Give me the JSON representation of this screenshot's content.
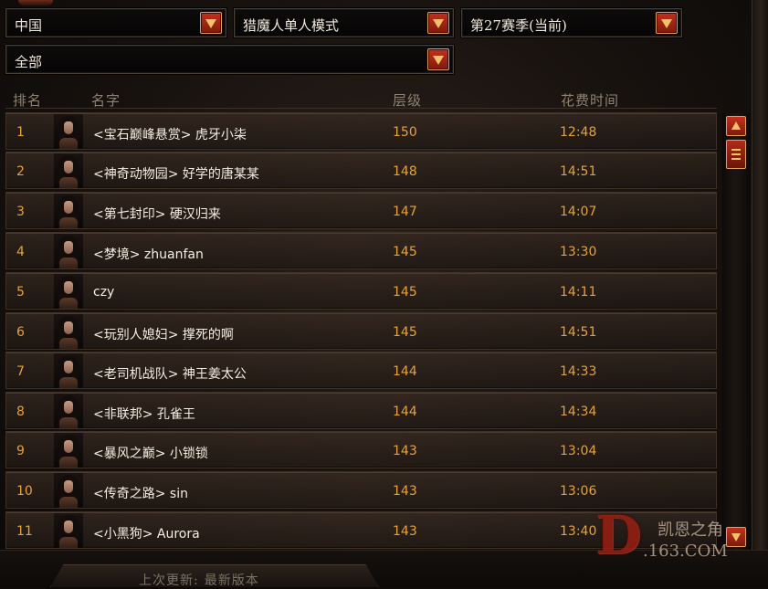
{
  "filters": {
    "region": "中国",
    "mode": "猎魔人单人模式",
    "season": "第27赛季(当前)",
    "class_filter": "全部"
  },
  "table": {
    "headers": {
      "rank": "排名",
      "name": "名字",
      "level": "层级",
      "time": "花费时间"
    },
    "rows": [
      {
        "rank": "1",
        "name": "<宝石巅峰悬赏> 虎牙小柒",
        "level": "150",
        "time": "12:48"
      },
      {
        "rank": "2",
        "name": "<神奇动物园> 好学的唐某某",
        "level": "148",
        "time": "14:51"
      },
      {
        "rank": "3",
        "name": "<第七封印> 硬汉归来",
        "level": "147",
        "time": "14:07"
      },
      {
        "rank": "4",
        "name": "<梦境> zhuanfan",
        "level": "145",
        "time": "13:30"
      },
      {
        "rank": "5",
        "name": "czy",
        "level": "145",
        "time": "14:11"
      },
      {
        "rank": "6",
        "name": "<玩别人媳妇> 撑死的啊",
        "level": "145",
        "time": "14:51"
      },
      {
        "rank": "7",
        "name": "<老司机战队> 神王姜太公",
        "level": "144",
        "time": "14:33"
      },
      {
        "rank": "8",
        "name": "<非联邦> 孔雀王",
        "level": "144",
        "time": "14:34"
      },
      {
        "rank": "9",
        "name": "<暴风之巅> 小锁锁",
        "level": "143",
        "time": "13:04"
      },
      {
        "rank": "10",
        "name": "<传奇之路> sin",
        "level": "143",
        "time": "13:06"
      },
      {
        "rank": "11",
        "name": "<小黑狗> Aurora",
        "level": "143",
        "time": "13:40"
      }
    ]
  },
  "footer": {
    "last_update_label": "上次更新:",
    "last_update_value": "最新版本"
  },
  "watermark": {
    "letter": "D",
    "site_name": "凯恩之角",
    "domain": ".163.COM"
  },
  "colors": {
    "accent_gold": "#e6a23a",
    "button_red": "#c2311b"
  },
  "icons": {
    "dropdown": "chevron-down-icon",
    "scroll_up": "arrow-up-icon",
    "scroll_down": "arrow-down-icon",
    "portrait": "demon-hunter-portrait"
  }
}
